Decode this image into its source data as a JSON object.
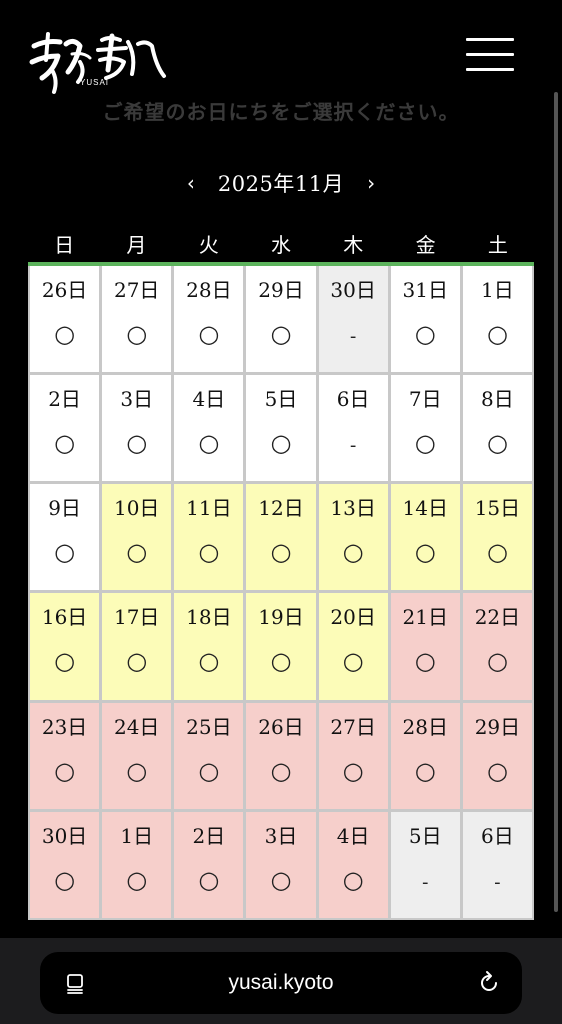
{
  "header": {
    "logo_sub": "YUSAI",
    "subtitle": "ご希望のお日にちをご選択ください。",
    "menu_icon": "hamburger-icon"
  },
  "calendar": {
    "month_label": "2025年11月",
    "prev_arrow": "‹",
    "next_arrow": "›",
    "weekdays": [
      "日",
      "月",
      "火",
      "水",
      "木",
      "金",
      "土"
    ],
    "status_legend": {
      "available": "○",
      "unavailable": "-"
    },
    "colors": {
      "white": "#ffffff",
      "yellow": "#fcfcb8",
      "pink": "#f6cfcb",
      "gray": "#eeeeee",
      "accent_line": "#5cb35c"
    },
    "days": [
      {
        "label": "26日",
        "status": "○",
        "color": "white"
      },
      {
        "label": "27日",
        "status": "○",
        "color": "white"
      },
      {
        "label": "28日",
        "status": "○",
        "color": "white"
      },
      {
        "label": "29日",
        "status": "○",
        "color": "white"
      },
      {
        "label": "30日",
        "status": "-",
        "color": "gray"
      },
      {
        "label": "31日",
        "status": "○",
        "color": "white"
      },
      {
        "label": "1日",
        "status": "○",
        "color": "white"
      },
      {
        "label": "2日",
        "status": "○",
        "color": "white"
      },
      {
        "label": "3日",
        "status": "○",
        "color": "white"
      },
      {
        "label": "4日",
        "status": "○",
        "color": "white"
      },
      {
        "label": "5日",
        "status": "○",
        "color": "white"
      },
      {
        "label": "6日",
        "status": "-",
        "color": "white"
      },
      {
        "label": "7日",
        "status": "○",
        "color": "white"
      },
      {
        "label": "8日",
        "status": "○",
        "color": "white"
      },
      {
        "label": "9日",
        "status": "○",
        "color": "white"
      },
      {
        "label": "10日",
        "status": "○",
        "color": "yellow"
      },
      {
        "label": "11日",
        "status": "○",
        "color": "yellow"
      },
      {
        "label": "12日",
        "status": "○",
        "color": "yellow"
      },
      {
        "label": "13日",
        "status": "○",
        "color": "yellow"
      },
      {
        "label": "14日",
        "status": "○",
        "color": "yellow"
      },
      {
        "label": "15日",
        "status": "○",
        "color": "yellow"
      },
      {
        "label": "16日",
        "status": "○",
        "color": "yellow"
      },
      {
        "label": "17日",
        "status": "○",
        "color": "yellow"
      },
      {
        "label": "18日",
        "status": "○",
        "color": "yellow"
      },
      {
        "label": "19日",
        "status": "○",
        "color": "yellow"
      },
      {
        "label": "20日",
        "status": "○",
        "color": "yellow"
      },
      {
        "label": "21日",
        "status": "○",
        "color": "pink"
      },
      {
        "label": "22日",
        "status": "○",
        "color": "pink"
      },
      {
        "label": "23日",
        "status": "○",
        "color": "pink"
      },
      {
        "label": "24日",
        "status": "○",
        "color": "pink"
      },
      {
        "label": "25日",
        "status": "○",
        "color": "pink"
      },
      {
        "label": "26日",
        "status": "○",
        "color": "pink"
      },
      {
        "label": "27日",
        "status": "○",
        "color": "pink"
      },
      {
        "label": "28日",
        "status": "○",
        "color": "pink"
      },
      {
        "label": "29日",
        "status": "○",
        "color": "pink"
      },
      {
        "label": "30日",
        "status": "○",
        "color": "pink"
      },
      {
        "label": "1日",
        "status": "○",
        "color": "pink"
      },
      {
        "label": "2日",
        "status": "○",
        "color": "pink"
      },
      {
        "label": "3日",
        "status": "○",
        "color": "pink"
      },
      {
        "label": "4日",
        "status": "○",
        "color": "pink"
      },
      {
        "label": "5日",
        "status": "-",
        "color": "gray"
      },
      {
        "label": "6日",
        "status": "-",
        "color": "gray"
      }
    ]
  },
  "browser": {
    "url": "yusai.kyoto",
    "reader_icon": "reader-mode-icon",
    "reload_icon": "reload-icon"
  }
}
